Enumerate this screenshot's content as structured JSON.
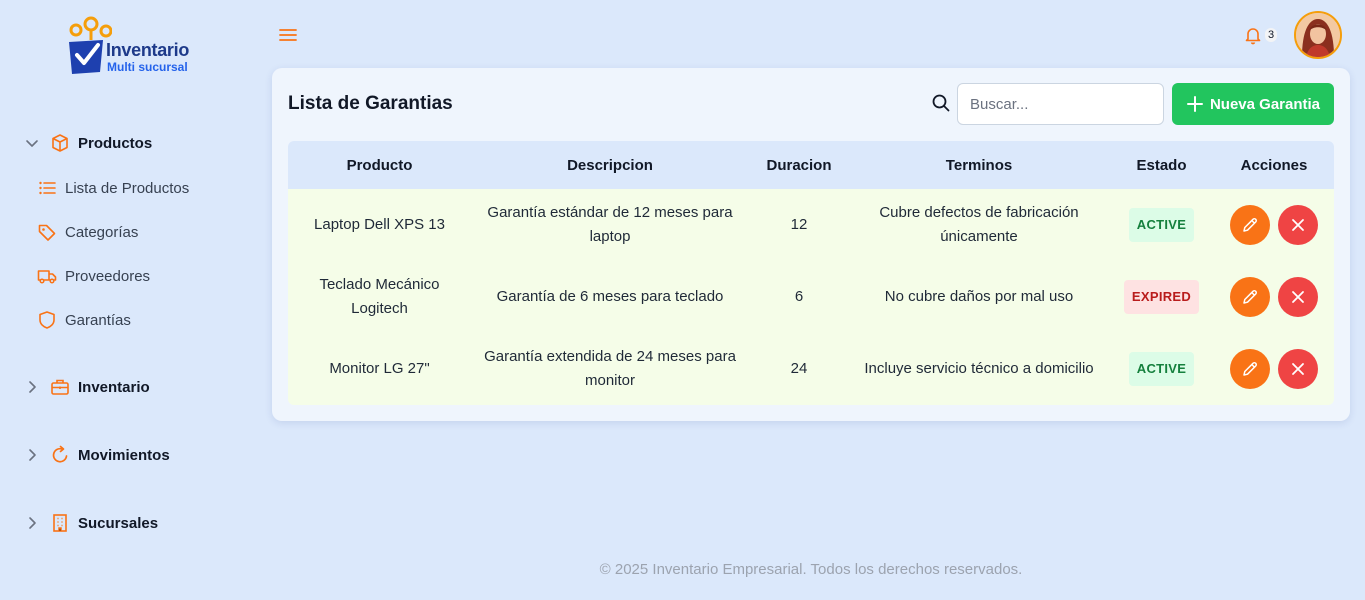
{
  "brand": {
    "title": "Inventario",
    "subtitle": "Multi sucursal"
  },
  "sidebar": {
    "sections": [
      {
        "label": "Productos",
        "icon": "box-icon",
        "expanded": true,
        "items": [
          {
            "label": "Lista de Productos",
            "icon": "list-icon"
          },
          {
            "label": "Categorías",
            "icon": "tag-icon"
          },
          {
            "label": "Proveedores",
            "icon": "truck-icon"
          },
          {
            "label": "Garantías",
            "icon": "shield-icon"
          }
        ]
      },
      {
        "label": "Inventario",
        "icon": "briefcase-icon",
        "expanded": false
      },
      {
        "label": "Movimientos",
        "icon": "refresh-icon",
        "expanded": false
      },
      {
        "label": "Sucursales",
        "icon": "building-icon",
        "expanded": false
      }
    ]
  },
  "header": {
    "notifications_count": "3"
  },
  "main": {
    "title": "Lista de Garantias",
    "search": {
      "placeholder": "Buscar...",
      "value": ""
    },
    "new_button_label": "Nueva Garantia",
    "table": {
      "columns": [
        "Producto",
        "Descripcion",
        "Duracion",
        "Terminos",
        "Estado",
        "Acciones"
      ],
      "rows": [
        {
          "producto": "Laptop Dell XPS 13",
          "descripcion": "Garantía estándar de 12 meses para laptop",
          "duracion": "12",
          "terminos": "Cubre defectos de fabricación únicamente",
          "estado": "ACTIVE"
        },
        {
          "producto": "Teclado Mecánico Logitech",
          "descripcion": "Garantía de 6 meses para teclado",
          "duracion": "6",
          "terminos": "No cubre daños por mal uso",
          "estado": "EXPIRED"
        },
        {
          "producto": "Monitor LG 27\"",
          "descripcion": "Garantía extendida de 24 meses para monitor",
          "duracion": "24",
          "terminos": "Incluye servicio técnico a domicilio",
          "estado": "ACTIVE"
        }
      ]
    }
  },
  "footer": {
    "text": "© 2025 Inventario Empresarial. Todos los derechos reservados."
  },
  "colors": {
    "accent": "#f97316",
    "primary_button": "#22c55e",
    "danger": "#ef4444",
    "brand_blue": "#1e3a8a"
  }
}
